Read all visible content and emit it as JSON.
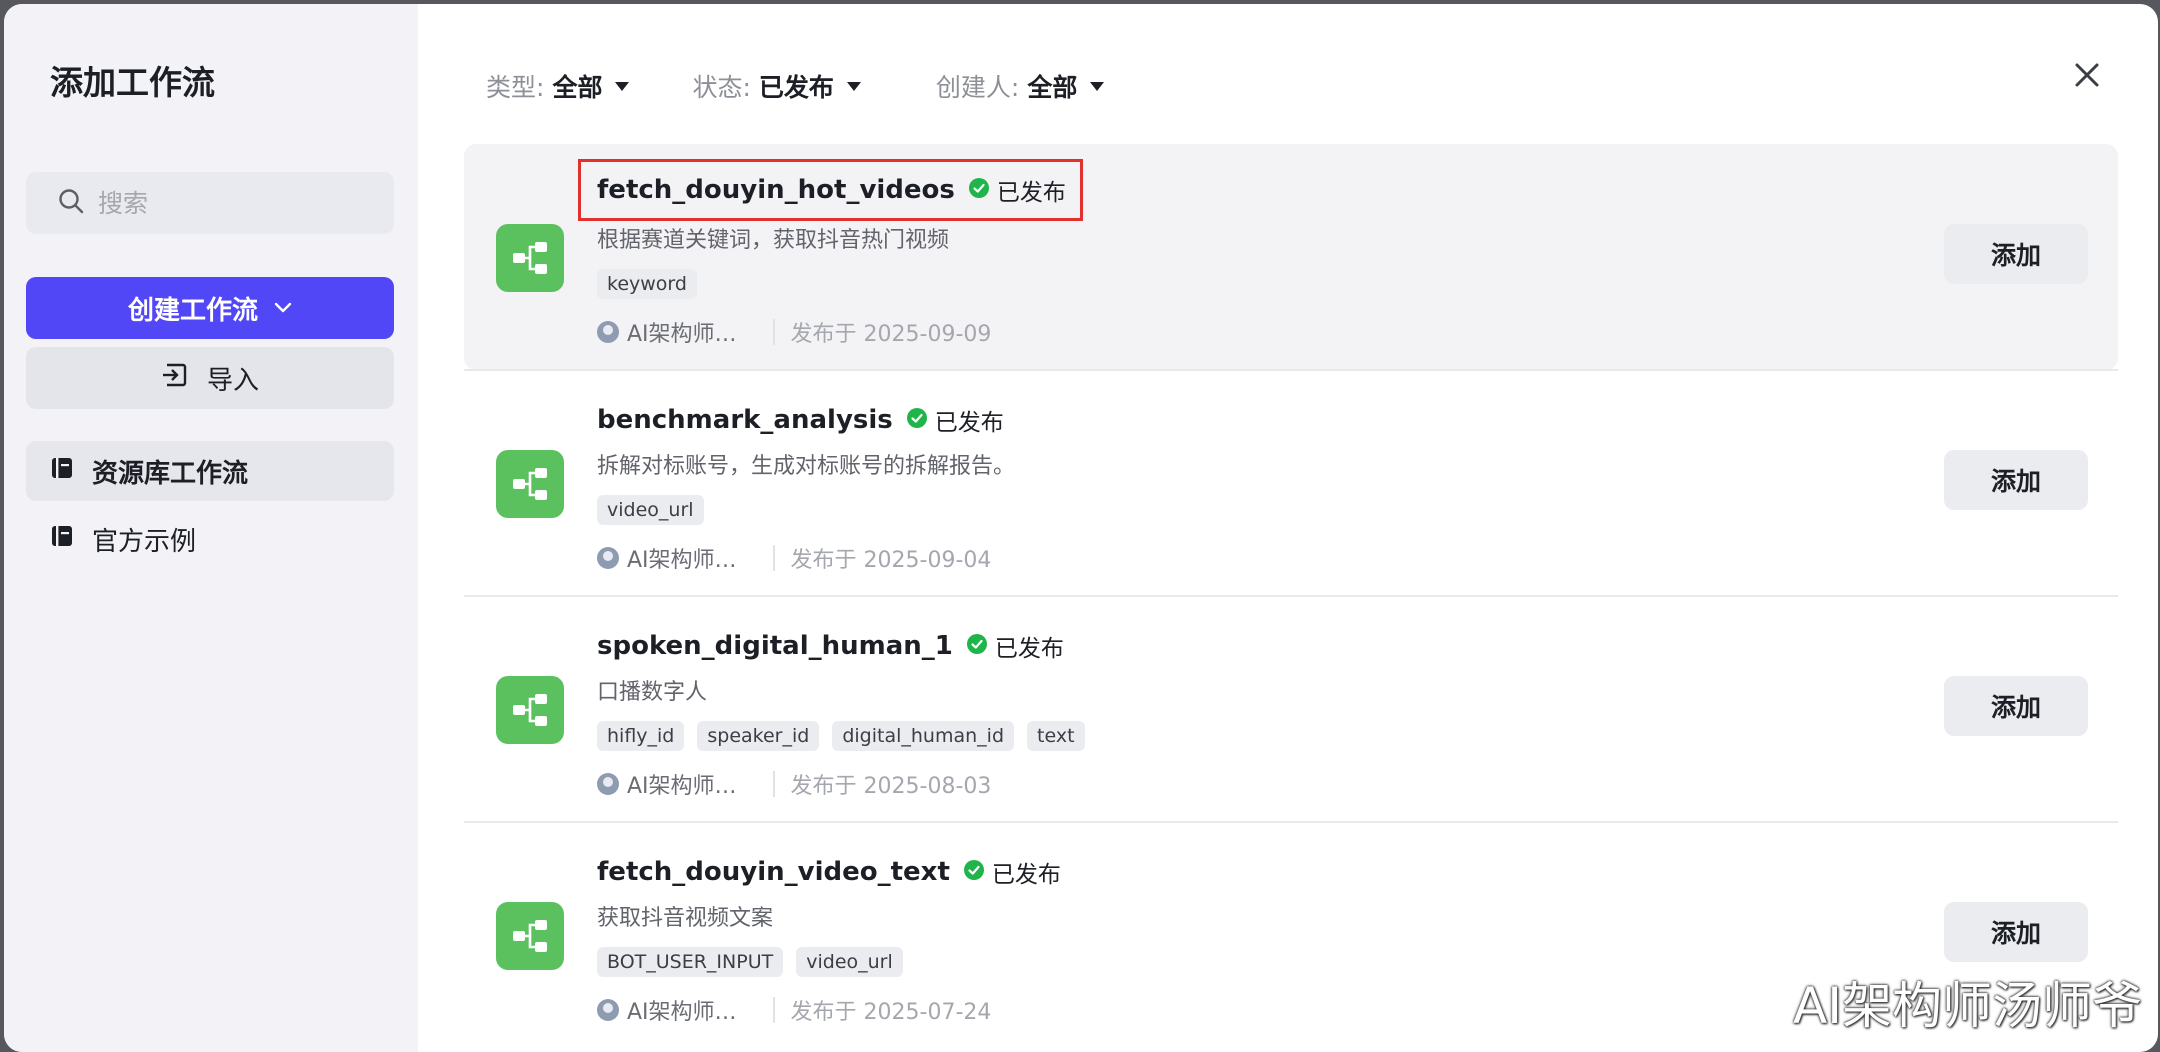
{
  "sidebar": {
    "title": "添加工作流",
    "search_placeholder": "搜索",
    "create_label": "创建工作流",
    "import_label": "导入",
    "nav": [
      {
        "label": "资源库工作流",
        "active": true
      },
      {
        "label": "官方示例",
        "active": false
      }
    ]
  },
  "filters": [
    {
      "label": "类型:",
      "value": "全部"
    },
    {
      "label": "状态:",
      "value": "已发布"
    },
    {
      "label": "创建人:",
      "value": "全部"
    }
  ],
  "workflows": [
    {
      "name": "fetch_douyin_hot_videos",
      "status": "已发布",
      "description": "根据赛道关键词，获取抖音热门视频",
      "tags": [
        "keyword"
      ],
      "author": "AI架构师…",
      "published": "发布于 2025-09-09",
      "add_label": "添加"
    },
    {
      "name": "benchmark_analysis",
      "status": "已发布",
      "description": "拆解对标账号，生成对标账号的拆解报告。",
      "tags": [
        "video_url"
      ],
      "author": "AI架构师…",
      "published": "发布于 2025-09-04",
      "add_label": "添加"
    },
    {
      "name": "spoken_digital_human_1",
      "status": "已发布",
      "description": "口播数字人",
      "tags": [
        "hifly_id",
        "speaker_id",
        "digital_human_id",
        "text"
      ],
      "author": "AI架构师…",
      "published": "发布于 2025-08-03",
      "add_label": "添加"
    },
    {
      "name": "fetch_douyin_video_text",
      "status": "已发布",
      "description": "获取抖音视频文案",
      "tags": [
        "BOT_USER_INPUT",
        "video_url"
      ],
      "author": "AI架构师…",
      "published": "发布于 2025-07-24",
      "add_label": "添加"
    }
  ],
  "watermark": "AI架构师汤师爷",
  "colors": {
    "primary": "#5147f6",
    "workflow_icon": "#5bc15f",
    "status_ok": "#1fb54a",
    "highlight_box": "#e2302c"
  },
  "icons": {
    "search": "search-icon",
    "create_chevron": "chevron-down-icon",
    "import": "import-icon",
    "nav": "book-icon",
    "filter_caret": "caret-down-icon",
    "close": "close-icon",
    "workflow": "workflow-icon",
    "status": "check-circle-icon"
  }
}
